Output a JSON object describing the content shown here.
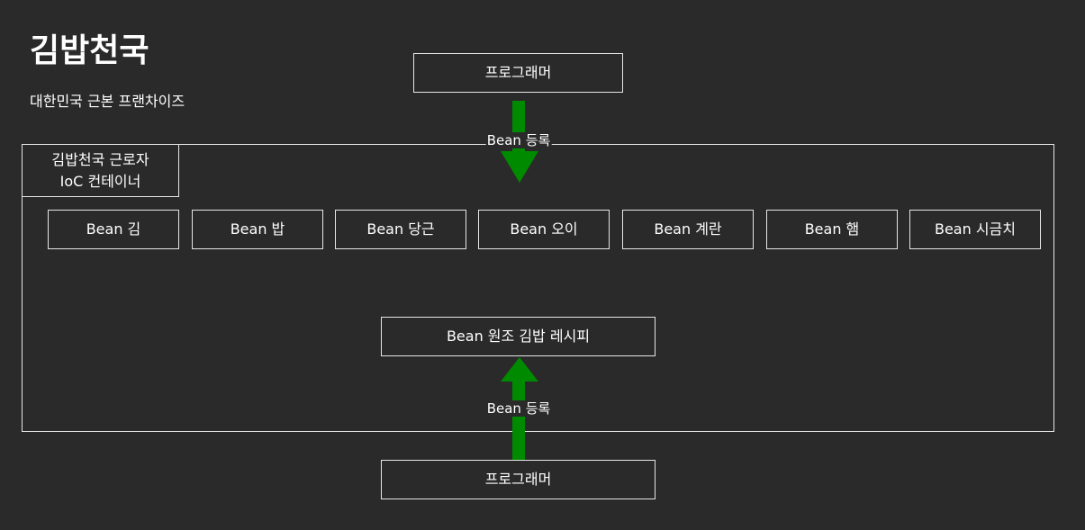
{
  "header": {
    "title": "김밥천국",
    "subtitle": "대한민국 근본 프랜차이즈"
  },
  "programmer_top": "프로그래머",
  "programmer_bottom": "프로그래머",
  "edges": {
    "top_label": "Bean 등록",
    "bottom_label": "Bean 등록"
  },
  "container": {
    "label_line1": "김밥천국 근로자",
    "label_line2": "IoC 컨테이너"
  },
  "beans": [
    "Bean 김",
    "Bean 밥",
    "Bean 당근",
    "Bean 오이",
    "Bean 계란",
    "Bean 햄",
    "Bean 시금치"
  ],
  "recipe": "Bean 원조 김밥 레시피",
  "colors": {
    "background": "#2a2a2a",
    "stroke": "#e6e6e6",
    "arrow": "#008a00"
  }
}
